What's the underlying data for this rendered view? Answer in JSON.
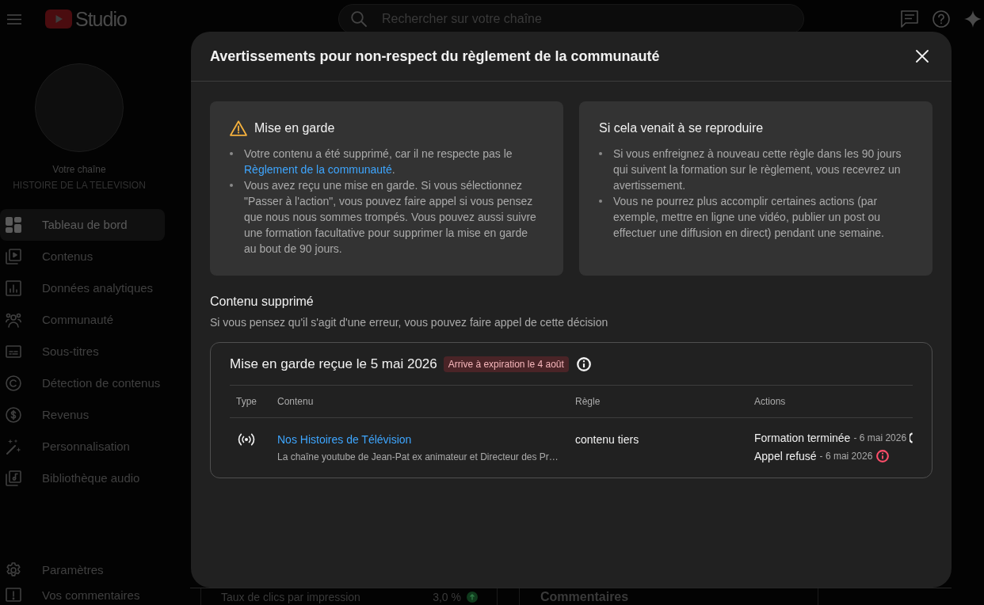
{
  "top_bar": {
    "logo_text": "Studio",
    "search": {
      "placeholder": "Rechercher sur votre chaîne"
    }
  },
  "channel": {
    "label": "Votre chaîne",
    "name": "HISTOIRE DE LA TELEVISION"
  },
  "sidebar": {
    "items": [
      {
        "label": "Tableau de bord",
        "selected": true
      },
      {
        "label": "Contenus",
        "selected": false
      },
      {
        "label": "Données analytiques",
        "selected": false
      },
      {
        "label": "Communauté",
        "selected": false
      },
      {
        "label": "Sous-titres",
        "selected": false
      },
      {
        "label": "Détection de contenus",
        "selected": false
      },
      {
        "label": "Revenus",
        "selected": false
      },
      {
        "label": "Personnalisation",
        "selected": false
      },
      {
        "label": "Bibliothèque audio",
        "selected": false
      }
    ],
    "footer_items": [
      {
        "label": "Paramètres",
        "selected": false
      },
      {
        "label": "Vos commentaires",
        "selected": false
      }
    ]
  },
  "dashboard": {
    "metric": {
      "label": "Taux de clics par impression",
      "value": "3,0 %"
    },
    "comments_card": {
      "title": "Commentaires"
    }
  },
  "dialog": {
    "title": "Avertissements pour non-respect du règlement de la communauté",
    "cards": [
      {
        "kind": "warning",
        "title": "Mise en garde",
        "bullets": [
          {
            "text": "Votre contenu a été supprimé, car il ne respecte pas le",
            "link": "Règlement de la communauté",
            "after": "."
          },
          {
            "text": "Vous avez reçu une mise en garde. Si vous sélectionnez \"Passer à l'action\", vous pouvez faire appel si vous pensez que nous nous sommes trompés. Vous pouvez aussi suivre une formation facultative pour supprimer la mise en garde au bout de 90 jours."
          }
        ]
      },
      {
        "kind": "plain",
        "title": "Si cela venait à se reproduire",
        "bullets": [
          {
            "text": "Si vous enfreignez à nouveau cette règle dans les 90 jours qui suivent la formation sur le règlement, vous recevrez un avertissement."
          },
          {
            "text": "Vous ne pourrez plus accomplir certaines actions (par exemple, mettre en ligne une vidéo, publier un post ou effectuer une diffusion en direct) pendant une semaine."
          }
        ]
      }
    ],
    "section": {
      "title": "Contenu supprimé",
      "subtitle": "Si vous pensez qu'il s'agit d'une erreur, vous pouvez faire appel de cette décision"
    },
    "strike": {
      "title": "Mise en garde reçue le 5 mai 2026",
      "badge": "Arrive à expiration le 4 août",
      "table": {
        "columns": [
          "Type",
          "Contenu",
          "Règle",
          "Actions"
        ],
        "rows": [
          {
            "title": "Nos Histoires de Télévision",
            "description": "La chaîne youtube de Jean-Pat ex animateur et Directeur des Pr…",
            "rule": "contenu tiers",
            "actions": [
              {
                "kind": "cut",
                "label": "Formation terminée",
                "date": "- 6 mai 2026",
                "color": "#f1f1f1"
              },
              {
                "kind": "full",
                "label": "Appel refusé",
                "date": "- 6 mai 2026",
                "color": "#ff4e6a"
              }
            ]
          }
        ]
      }
    }
  }
}
